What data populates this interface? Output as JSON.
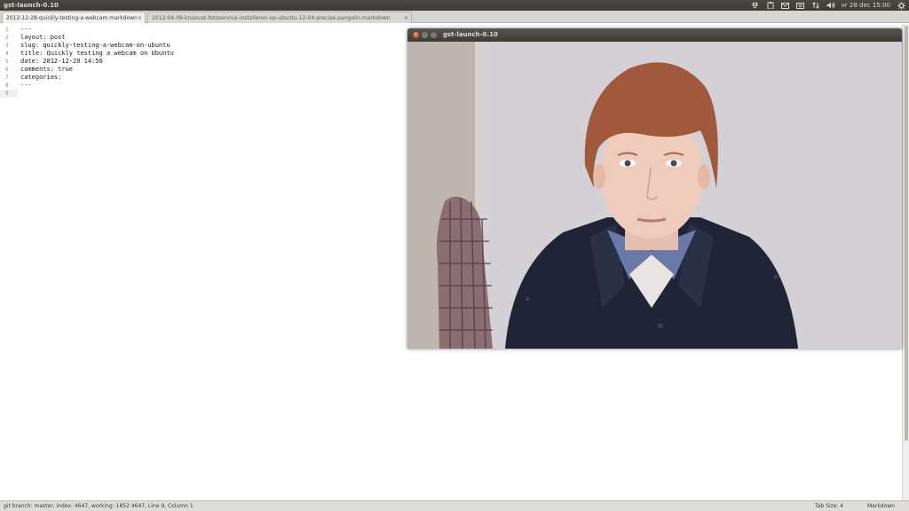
{
  "panel": {
    "title": "gst-launch-0.10",
    "clock": "vr 28 dec 15:00"
  },
  "tabs": [
    {
      "label": "2012-12-28-quickly-testing-a-webcam.markdown",
      "active": true
    },
    {
      "label": "2012-04-09-kruisvat-fotoservice-installeren-op-ubuntu-12-04-precise-pangolin.markdown",
      "active": false
    }
  ],
  "editor": {
    "line_numbers": [
      "1",
      "2",
      "3",
      "4",
      "5",
      "6",
      "7",
      "8",
      "9"
    ],
    "lines": [
      "---",
      "layout: post",
      "slug: quickly-testing-a-webcam-on-ubuntu",
      "title: Quickly testing a webcam on Ubuntu",
      "date: 2012-12-28 14:56",
      "comments: true",
      "categories:",
      "---",
      ""
    ]
  },
  "status": {
    "left": "git branch: master, index: 4647, working: 1852 4647, Line 9, Column 1",
    "tab_size": "Tab Size: 4",
    "syntax": "Markdown"
  },
  "gst_window": {
    "title": "gst-launch-0.10",
    "content": "webcam video feed"
  },
  "colors": {
    "panel_bg": "#3c3b37",
    "close_button": "#e05a2a",
    "editor_bg": "#ffffff"
  }
}
